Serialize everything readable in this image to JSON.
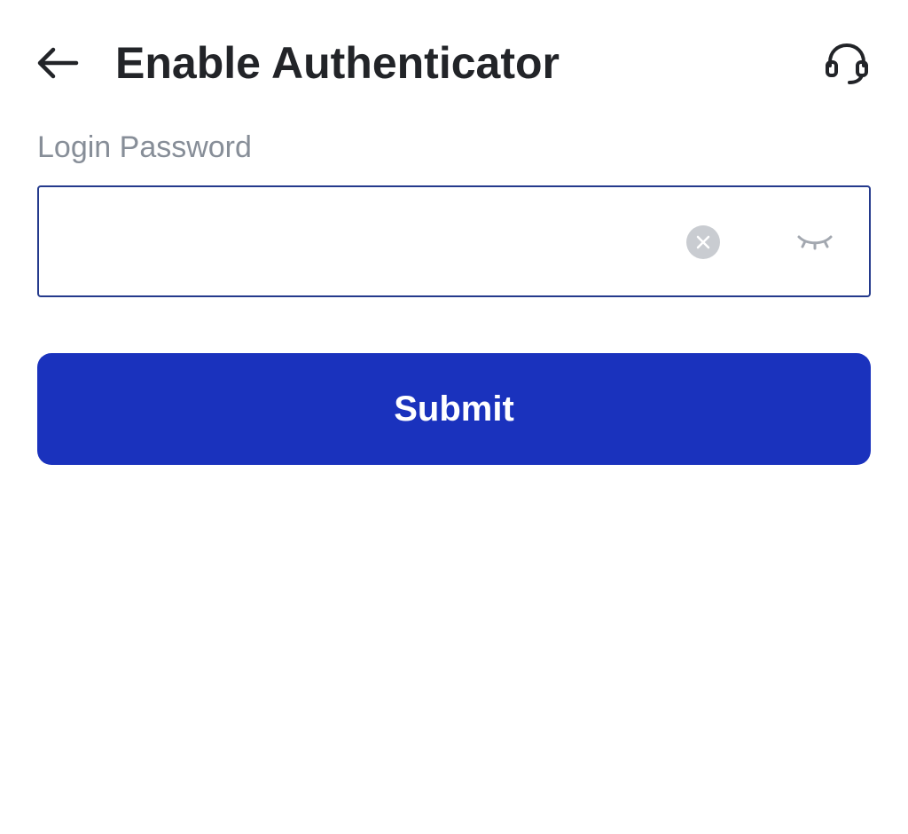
{
  "header": {
    "back_icon": "arrow-left-icon",
    "title": "Enable Authenticator",
    "support_icon": "headset-icon"
  },
  "form": {
    "password_label": "Login Password",
    "password_value": "",
    "clear_icon": "clear-circle-icon",
    "visibility_icon": "eye-closed-icon"
  },
  "actions": {
    "submit_label": "Submit"
  },
  "colors": {
    "primary": "#1a32bd",
    "input_border": "#243a8c",
    "label": "#878e98",
    "title": "#222428",
    "icon_muted": "#c9ccd1"
  }
}
